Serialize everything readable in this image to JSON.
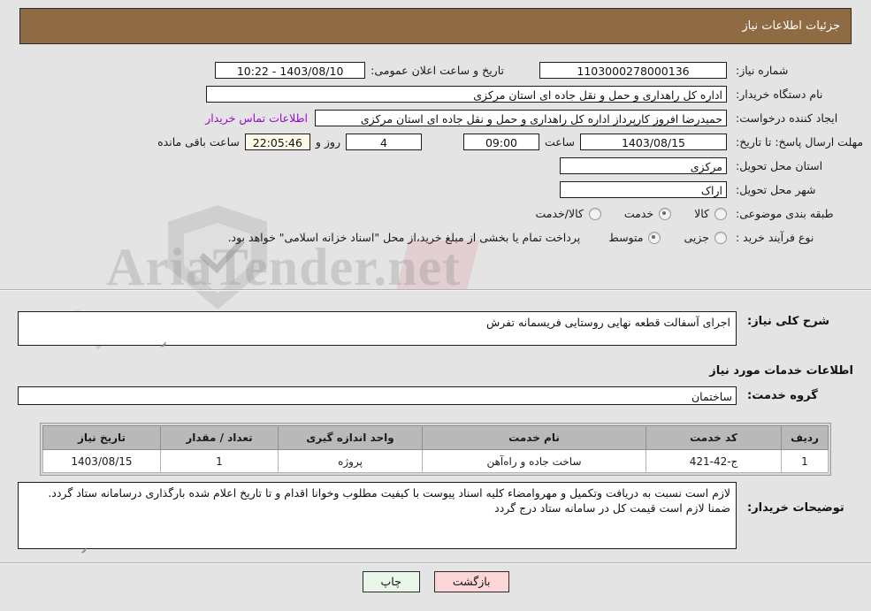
{
  "header": {
    "title": "جزئیات اطلاعات نیاز",
    "bg_color": "#8e6b43"
  },
  "form": {
    "need_number_label": "شماره نیاز:",
    "need_number_value": "1103000278000136",
    "announce_label": "تاریخ و ساعت اعلان عمومی:",
    "announce_value": "1403/08/10 - 10:22",
    "buyer_org_label": "نام دستگاه خریدار:",
    "buyer_org_value": "اداره کل راهداری و حمل و نقل جاده ای استان مرکزی",
    "creator_label": "ایجاد کننده درخواست:",
    "creator_value": "حمیدرضا  افروز  کارپرداز اداره کل راهداری و حمل و نقل جاده ای استان مرکزی",
    "contact_link": "اطلاعات تماس خریدار",
    "deadline_label": "مهلت ارسال پاسخ: تا تاریخ:",
    "deadline_date": "1403/08/15",
    "hour_label": "ساعت",
    "deadline_time": "09:00",
    "days_value": "4",
    "days_label": "روز و",
    "remaining_time": "22:05:46",
    "remaining_label": "ساعت باقی مانده",
    "province_label": "استان محل تحویل:",
    "province_value": "مرکزی",
    "city_label": "شهر محل تحویل:",
    "city_value": "اراک",
    "category_label": "طبقه بندی موضوعی:",
    "category_options": [
      "کالا",
      "خدمت",
      "کالا/خدمت"
    ],
    "category_selected": "خدمت",
    "process_label": "نوع فرآیند خرید :",
    "process_options": [
      "جزیی",
      "متوسط"
    ],
    "process_selected": "متوسط",
    "process_note": "پرداخت تمام یا بخشی از مبلغ خرید،از محل \"اسناد خزانه اسلامی\" خواهد بود."
  },
  "general": {
    "label": "شرح کلی نیاز:",
    "value": "اجرای آسفالت قطعه نهایی روستایی فریسمانه تفرش"
  },
  "service_info": {
    "heading": "اطلاعات خدمات مورد نیاز",
    "group_label": "گروه خدمت:",
    "group_value": "ساختمان"
  },
  "table": {
    "columns": [
      "ردیف",
      "کد خدمت",
      "نام خدمت",
      "واحد اندازه گیری",
      "تعداد / مقدار",
      "تاریخ نیاز"
    ],
    "rows": [
      {
        "row_no": "1",
        "service_code": "ج-42-421",
        "service_name": "ساخت جاده و راه‌آهن",
        "unit": "پروژه",
        "quantity": "1",
        "need_date": "1403/08/15"
      }
    ]
  },
  "buyer_notes": {
    "label": "توضیحات خریدار:",
    "value": "لازم است نسبت به دریافت وتکمیل و مهروامضاء کلیه اسناد پیوست با کیفیت مطلوب وخوانا اقدام و تا تاریخ اعلام شده بارگذاری درسامانه ستاد گردد. ضمنا لازم است قیمت کل در سامانه ستاد درج گردد"
  },
  "buttons": {
    "print": "چاپ",
    "back": "بازگشت"
  },
  "watermark": {
    "text": "AriaTender.net"
  }
}
